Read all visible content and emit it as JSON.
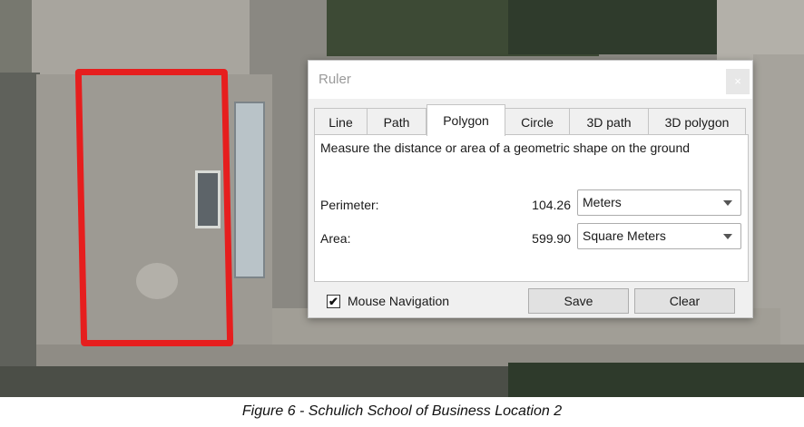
{
  "dialog": {
    "title": "Ruler",
    "close_symbol": "×",
    "tabs": [
      {
        "label": "Line",
        "active": false
      },
      {
        "label": "Path",
        "active": false
      },
      {
        "label": "Polygon",
        "active": true
      },
      {
        "label": "Circle",
        "active": false
      },
      {
        "label": "3D path",
        "active": false
      },
      {
        "label": "3D polygon",
        "active": false
      }
    ],
    "description": "Measure the distance or area of a geometric shape on the ground",
    "perimeter": {
      "label": "Perimeter:",
      "value": "104.26",
      "unit": "Meters"
    },
    "area": {
      "label": "Area:",
      "value": "599.90",
      "unit": "Square Meters"
    },
    "mouse_navigation": {
      "label": "Mouse Navigation",
      "checked": true,
      "check_mark": "✔"
    },
    "save_label": "Save",
    "clear_label": "Clear"
  },
  "caption": "Figure 6 - Schulich School of Business Location 2",
  "colors": {
    "outline": "#e61e1e",
    "dialog_bg": "#f0f0f0",
    "panel_bg": "#ffffff"
  }
}
